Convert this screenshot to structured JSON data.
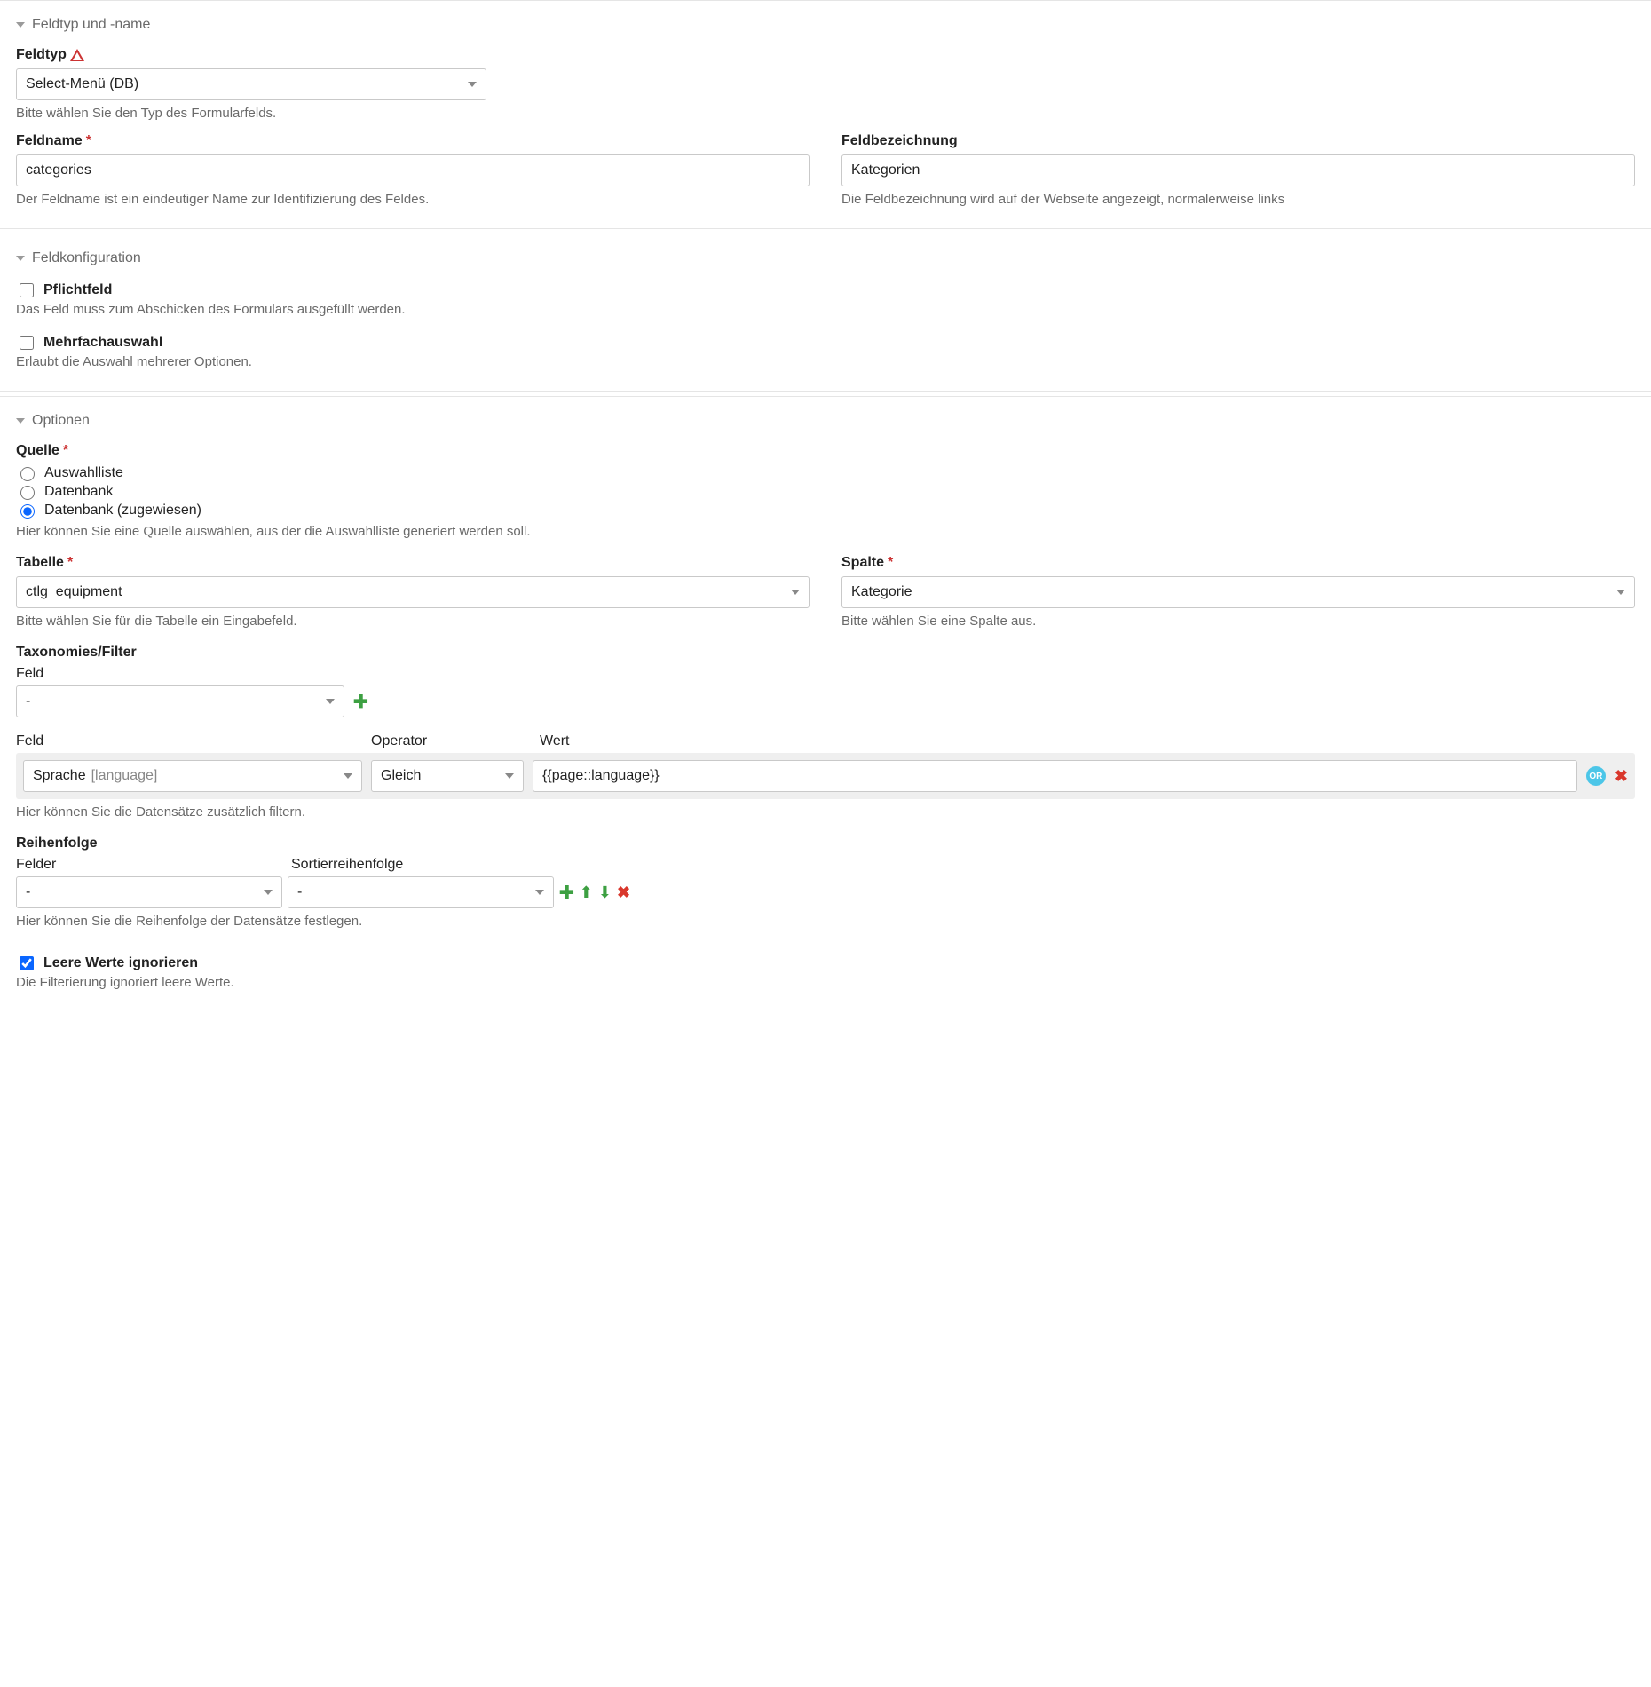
{
  "sections": {
    "s1": {
      "title": "Feldtyp und -name"
    },
    "s2": {
      "title": "Feldkonfiguration"
    },
    "s3": {
      "title": "Optionen"
    }
  },
  "feldtyp": {
    "label": "Feldtyp",
    "value": "Select-Menü (DB)",
    "help": "Bitte wählen Sie den Typ des Formularfelds."
  },
  "feldname": {
    "label": "Feldname",
    "value": "categories",
    "help": "Der Feldname ist ein eindeutiger Name zur Identifizierung des Feldes."
  },
  "feldbez": {
    "label": "Feldbezeichnung",
    "value": "Kategorien",
    "help": "Die Feldbezeichnung wird auf der Webseite angezeigt, normalerweise links"
  },
  "pflicht": {
    "label": "Pflichtfeld",
    "help": "Das Feld muss zum Abschicken des Formulars ausgefüllt werden."
  },
  "mehrfach": {
    "label": "Mehrfachauswahl",
    "help": "Erlaubt die Auswahl mehrerer Optionen."
  },
  "quelle": {
    "label": "Quelle",
    "opt1": "Auswahlliste",
    "opt2": "Datenbank",
    "opt3": "Datenbank (zugewiesen)",
    "help": "Hier können Sie eine Quelle auswählen, aus der die Auswahlliste generiert werden soll."
  },
  "tabelle": {
    "label": "Tabelle",
    "value": "ctlg_equipment",
    "help": "Bitte wählen Sie für die Tabelle ein Eingabefeld."
  },
  "spalte": {
    "label": "Spalte",
    "value": "Kategorie",
    "help": "Bitte wählen Sie eine Spalte aus."
  },
  "tax": {
    "label": "Taxonomies/Filter",
    "feld_label": "Feld",
    "feld_value": "-",
    "f_feld_label": "Feld",
    "f_op_label": "Operator",
    "f_wert_label": "Wert",
    "f_feld_value": "Sprache",
    "f_feld_hint": "[language]",
    "f_op_value": "Gleich",
    "f_wert_value": "{{page::language}}",
    "help": "Hier können Sie die Datensätze zusätzlich filtern.",
    "or": "OR"
  },
  "reihen": {
    "label": "Reihenfolge",
    "felder_label": "Felder",
    "sort_label": "Sortierreihenfolge",
    "felder_value": "-",
    "sort_value": "-",
    "help": "Hier können Sie die Reihenfolge der Datensätze festlegen."
  },
  "leere": {
    "label": "Leere Werte ignorieren",
    "help": "Die Filterierung ignoriert leere Werte."
  }
}
